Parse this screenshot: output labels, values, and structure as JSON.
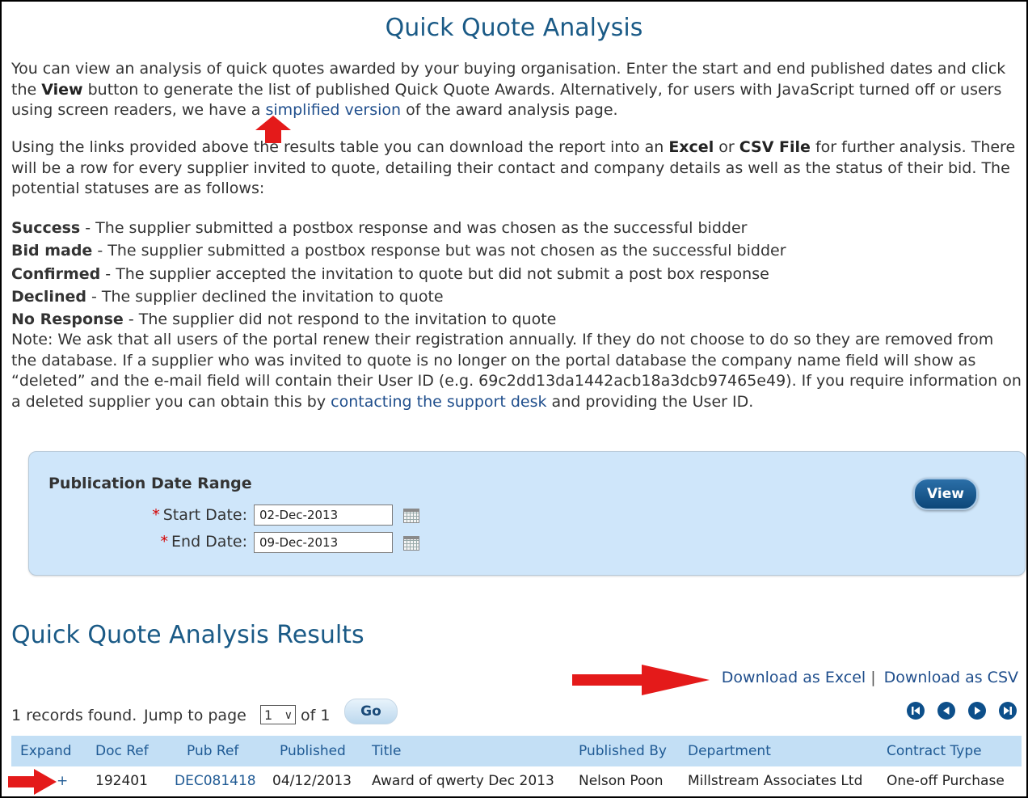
{
  "page": {
    "title": "Quick Quote Analysis"
  },
  "intro": {
    "p1_a": "You can view an analysis of quick quotes awarded by your buying organisation. Enter the start and end published dates and click the ",
    "p1_view": "View",
    "p1_b": " button to generate the list of published Quick Quote Awards. Alternatively, for users with JavaScript turned off or users using screen readers, we have a ",
    "p1_link": "simplified version",
    "p1_c": " of the award analysis page.",
    "p2_a": "Using the links provided above the results table you can download the report into an ",
    "p2_excel": "Excel",
    "p2_or": " or ",
    "p2_csv": "CSV File",
    "p2_b": " for further analysis. There will be a row for every supplier invited to quote, detailing their contact and company details as well as the status of their bid. The potential statuses are as follows:"
  },
  "statuses": [
    {
      "name": "Success",
      "desc": " - The supplier submitted a postbox response and was chosen as the successful bidder"
    },
    {
      "name": "Bid made",
      "desc": " - The supplier submitted a postbox response but was not chosen as the successful bidder"
    },
    {
      "name": "Confirmed",
      "desc": " - The supplier accepted the invitation to quote but did not submit a post box response"
    },
    {
      "name": "Declined",
      "desc": " - The supplier declined the invitation to quote"
    },
    {
      "name": "No Response",
      "desc": " - The supplier did not respond to the invitation to quote"
    }
  ],
  "note": {
    "text_a": "Note: We ask that all users of the portal renew their registration annually. If they do not choose to do so they are removed from the database. If a supplier who was invited to quote is no longer on the portal database the company name field will show as “deleted” and the e-mail field will contain their User ID (e.g. 69c2dd13da1442acb18a3dcb97465e49). If you require information on a deleted supplier you can obtain this by ",
    "link": "contacting the support desk",
    "text_b": " and providing the User ID."
  },
  "date_range": {
    "title": "Publication Date Range",
    "required_mark": "*",
    "start_label": "Start Date:",
    "start_value": "02-Dec-2013",
    "end_label": "End Date:",
    "end_value": "09-Dec-2013",
    "view_label": "View"
  },
  "results": {
    "title": "Quick Quote Analysis Results",
    "download_excel": "Download as Excel",
    "separator": "|",
    "download_csv": "Download as CSV",
    "records_text": "1 records found.",
    "jump_text": "Jump to page",
    "page_value": "1",
    "of_text": "of 1",
    "go_label": "Go",
    "columns": [
      "Expand",
      "Doc Ref",
      "Pub Ref",
      "Published",
      "Title",
      "Published By",
      "Department",
      "Contract Type"
    ],
    "rows": [
      {
        "expand": "+",
        "doc_ref": "192401",
        "pub_ref": "DEC081418",
        "published": "04/12/2013",
        "title": "Award of qwerty Dec 2013",
        "published_by": "Nelson Poon",
        "department": "Millstream Associates Ltd",
        "contract_type": "One-off Purchase"
      }
    ]
  },
  "icons": {
    "annotation_arrow_color": "#e41a1a",
    "nav": [
      "first-page-icon",
      "previous-page-icon",
      "next-page-icon",
      "last-page-icon"
    ]
  }
}
